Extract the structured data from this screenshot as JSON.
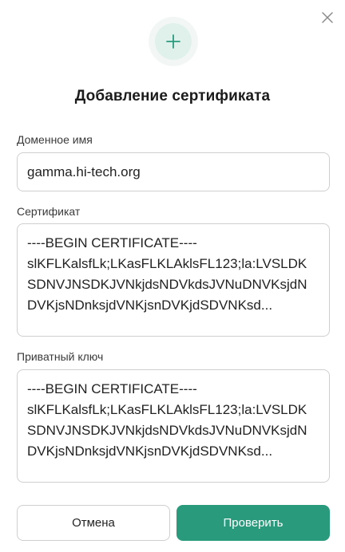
{
  "dialog": {
    "title": "Добавление сертификата"
  },
  "domain": {
    "label": "Доменное имя",
    "value": "gamma.hi-tech.org"
  },
  "certificate": {
    "label": "Сертификат",
    "lines": [
      "----BEGIN CERTIFICATE----",
      "slKFLKalsfLk;LKasFLKLAklsFL123;la:LVSLDK",
      "SDNVJNSDKJVNkjdsNDVkdsJVNuDNVKsjdN",
      "DVKjsNDnksjdVNKjsnDVKjdSDVNKsd..."
    ]
  },
  "private_key": {
    "label": "Приватный ключ",
    "lines": [
      "----BEGIN CERTIFICATE----",
      "slKFLKalsfLk;LKasFLKLAklsFL123;la:LVSLDK",
      "SDNVJNSDKJVNkjdsNDVkdsJVNuDNVKsjdN",
      "DVKjsNDnksjdVNKjsnDVKjdSDVNKsd..."
    ]
  },
  "buttons": {
    "cancel": "Отмена",
    "check": "Проверить"
  },
  "icons": {
    "close": "close-icon",
    "hero": "plus-icon"
  },
  "colors": {
    "accent": "#2a9a7d",
    "hero_bg": "#dff1ea"
  }
}
